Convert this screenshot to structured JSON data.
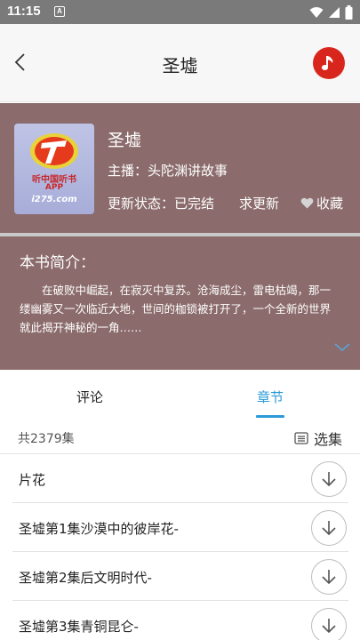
{
  "status_bar": {
    "time": "11:15",
    "notification": "A"
  },
  "appbar": {
    "title": "圣墟"
  },
  "book": {
    "title": "圣墟",
    "author": "主播：头陀渊讲故事",
    "status": "更新状态：已完结",
    "request_update": "求更新",
    "favorite": "收藏",
    "cover": {
      "line1": "听中国听书",
      "line2": "APP",
      "line3": "i275.com"
    }
  },
  "intro": {
    "heading": "本书简介：",
    "text": "在破败中崛起，在寂灭中复苏。沧海成尘，雷电枯竭，那一缕幽雾又一次临近大地，世间的枷锁被打开了，一个全新的世界就此揭开神秘的一角……"
  },
  "tabs": {
    "comments": "评论",
    "chapters": "章节",
    "active": "chapters"
  },
  "episodes_header": {
    "count": "共2379集",
    "select": "选集"
  },
  "episodes": [
    {
      "name": "片花"
    },
    {
      "name": "圣墟第1集沙漠中的彼岸花-"
    },
    {
      "name": "圣墟第2集后文明时代-"
    },
    {
      "name": "圣墟第3集青铜昆仑-"
    }
  ],
  "colors": {
    "accent": "#2a9ad8",
    "header_bg": "#8b6b6b",
    "music_button": "#d8261c"
  }
}
